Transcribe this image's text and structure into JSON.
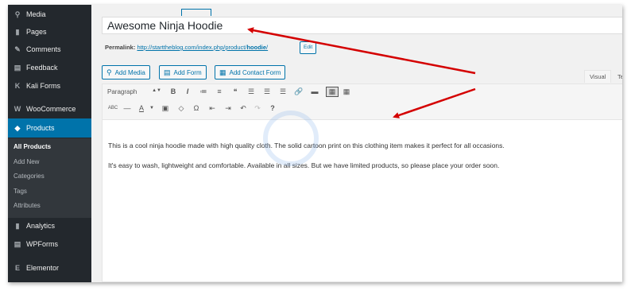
{
  "sidebar": {
    "items": [
      {
        "label": "Media",
        "icon": "media-icon",
        "glyph": "⚲"
      },
      {
        "label": "Pages",
        "icon": "pages-icon",
        "glyph": "▮"
      },
      {
        "label": "Comments",
        "icon": "comments-icon",
        "glyph": "✎"
      },
      {
        "label": "Feedback",
        "icon": "feedback-icon",
        "glyph": "▤"
      },
      {
        "label": "Kali Forms",
        "icon": "kali-forms-icon",
        "glyph": "K"
      },
      {
        "label": "WooCommerce",
        "icon": "woocommerce-icon",
        "glyph": "W"
      },
      {
        "label": "Products",
        "icon": "products-icon",
        "glyph": "◆"
      },
      {
        "label": "Analytics",
        "icon": "analytics-icon",
        "glyph": "▮"
      },
      {
        "label": "WPForms",
        "icon": "wpforms-icon",
        "glyph": "▤"
      },
      {
        "label": "Elementor",
        "icon": "elementor-icon",
        "glyph": "E"
      }
    ],
    "submenu": [
      "All Products",
      "Add New",
      "Categories",
      "Tags",
      "Attributes"
    ]
  },
  "editor": {
    "title": "Awesome Ninja Hoodie",
    "permalink_label": "Permalink:",
    "permalink_base": "http://starttheblog.com/index.php/product/",
    "permalink_slug": "hoodie",
    "permalink_end": "/",
    "edit_label": "Edit",
    "buttons": {
      "add_media": "Add Media",
      "add_form": "Add Form",
      "add_contact_form": "Add Contact Form"
    },
    "tabs": {
      "visual": "Visual",
      "text": "Te"
    },
    "format_select": "Paragraph",
    "paragraphs": [
      "This is a cool ninja hoodie made with high quality cloth. The solid cartoon print on this clothing item makes it perfect for all occasions.",
      "It's easy to wash, lightweight and comfortable. Available in all sizes. But we have limited products, so please place your order soon."
    ]
  },
  "toolbar_row1": [
    "B",
    "I",
    "≔",
    "≡",
    "❝",
    "☰",
    "☰",
    "☰",
    "🔗",
    "▬",
    "▦",
    "▦"
  ],
  "toolbar_row2": [
    "ABC",
    "—",
    "A",
    "▣",
    "◇",
    "Ω",
    "⇤",
    "⇥",
    "↶",
    "↷",
    "?"
  ],
  "colors": {
    "sidebar_bg": "#23282d",
    "accent": "#0073aa",
    "arrow": "#d40000"
  }
}
